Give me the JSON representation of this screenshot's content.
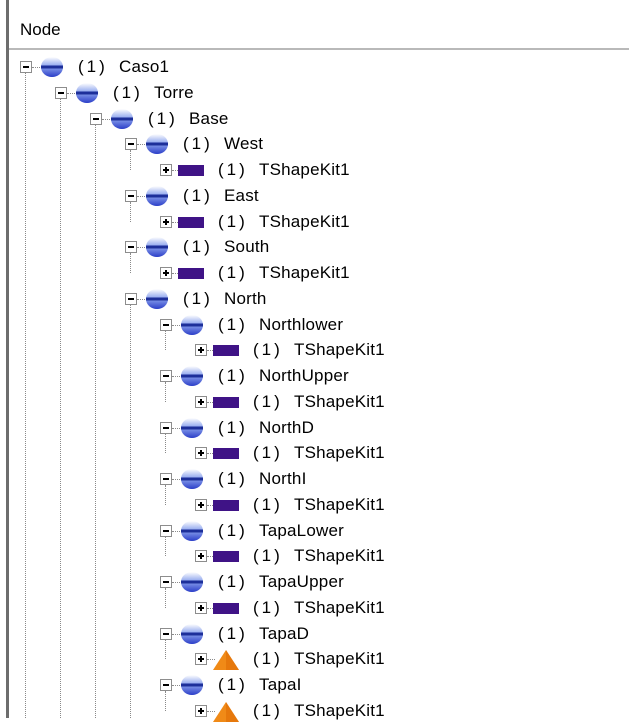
{
  "header": {
    "title": "Node"
  },
  "count_prefix": "(1)",
  "colors": {
    "kit_icon": "#3f1386",
    "sphere_top": "#ffffff",
    "sphere_bottom": "#2b3ec8",
    "cone": "#f08a17"
  },
  "nodes": [
    {
      "label": "Caso1",
      "icon": "sphere-icon",
      "expanded": true
    },
    {
      "label": "Torre",
      "icon": "sphere-icon",
      "expanded": true
    },
    {
      "label": "Base",
      "icon": "sphere-icon",
      "expanded": true
    },
    {
      "label": "West",
      "icon": "sphere-icon",
      "expanded": true
    },
    {
      "label": "TShapeKit1",
      "icon": "shape-kit-icon",
      "expanded": false
    },
    {
      "label": "East",
      "icon": "sphere-icon",
      "expanded": true
    },
    {
      "label": "TShapeKit1",
      "icon": "shape-kit-icon",
      "expanded": false
    },
    {
      "label": "South",
      "icon": "sphere-icon",
      "expanded": true
    },
    {
      "label": "TShapeKit1",
      "icon": "shape-kit-icon",
      "expanded": false
    },
    {
      "label": "North",
      "icon": "sphere-icon",
      "expanded": true
    },
    {
      "label": "Northlower",
      "icon": "sphere-icon",
      "expanded": true
    },
    {
      "label": "TShapeKit1",
      "icon": "shape-kit-icon",
      "expanded": false
    },
    {
      "label": "NorthUpper",
      "icon": "sphere-icon",
      "expanded": true
    },
    {
      "label": "TShapeKit1",
      "icon": "shape-kit-icon",
      "expanded": false
    },
    {
      "label": "NorthD",
      "icon": "sphere-icon",
      "expanded": true
    },
    {
      "label": "TShapeKit1",
      "icon": "shape-kit-icon",
      "expanded": false
    },
    {
      "label": "NorthI",
      "icon": "sphere-icon",
      "expanded": true
    },
    {
      "label": "TShapeKit1",
      "icon": "shape-kit-icon",
      "expanded": false
    },
    {
      "label": "TapaLower",
      "icon": "sphere-icon",
      "expanded": true
    },
    {
      "label": "TShapeKit1",
      "icon": "shape-kit-icon",
      "expanded": false
    },
    {
      "label": "TapaUpper",
      "icon": "sphere-icon",
      "expanded": true
    },
    {
      "label": "TShapeKit1",
      "icon": "shape-kit-icon",
      "expanded": false
    },
    {
      "label": "TapaD",
      "icon": "sphere-icon",
      "expanded": true
    },
    {
      "label": "TShapeKit1",
      "icon": "cone-icon",
      "expanded": false
    },
    {
      "label": "TapaI",
      "icon": "sphere-icon",
      "expanded": true
    },
    {
      "label": "TShapeKit1",
      "icon": "cone-icon",
      "expanded": false
    }
  ]
}
